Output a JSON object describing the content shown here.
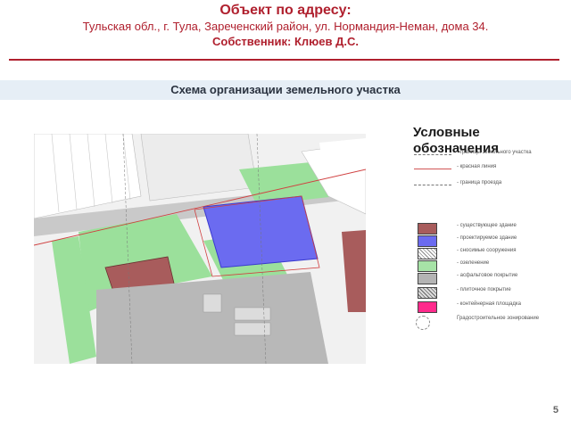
{
  "header": {
    "title": "Объект по адресу:",
    "address": "Тульская обл., г. Тула, Зареченский район, ул. Нормандия-Неман, дома 34.",
    "owner": "Собственник: Клюев Д.С."
  },
  "band": {
    "title": "Схема организации земельного участка"
  },
  "legend": {
    "title": "Условные обозначения",
    "items": [
      {
        "label": "- границы земельного участка",
        "symbol": "dash-line",
        "color": "#777777"
      },
      {
        "label": "- красная линия",
        "symbol": "line",
        "color": "#d15555"
      },
      {
        "label": "- граница проезда",
        "symbol": "dash-line",
        "color": "#777777"
      },
      {
        "label": "- существующее здание",
        "symbol": "box",
        "color": "#a85c5c"
      },
      {
        "label": "- проектируемое здание",
        "symbol": "box",
        "color": "#6b6bf0"
      },
      {
        "label": "- сносимые сооружения",
        "symbol": "hatch",
        "color": "#ffffff"
      },
      {
        "label": "- озеленение",
        "symbol": "box",
        "color": "#a7e3a7"
      },
      {
        "label": "- асфальтовое покрытие",
        "symbol": "box",
        "color": "#b4b4b4"
      },
      {
        "label": "- плиточное покрытие",
        "symbol": "cross",
        "color": "#cfcfcf"
      },
      {
        "label": "- контейнерная площадка",
        "symbol": "box",
        "color": "#ff2a8c"
      },
      {
        "label": "Градостроительное зонирование",
        "symbol": "circle",
        "color": "#888888"
      }
    ]
  },
  "page": {
    "number": "5"
  },
  "colors": {
    "accent": "#b0202e",
    "existing_building": "#a85c5c",
    "new_building": "#6b6bf0",
    "green": "#a7e3a7",
    "asphalt": "#b4b4b4",
    "container": "#ff2a8c"
  }
}
